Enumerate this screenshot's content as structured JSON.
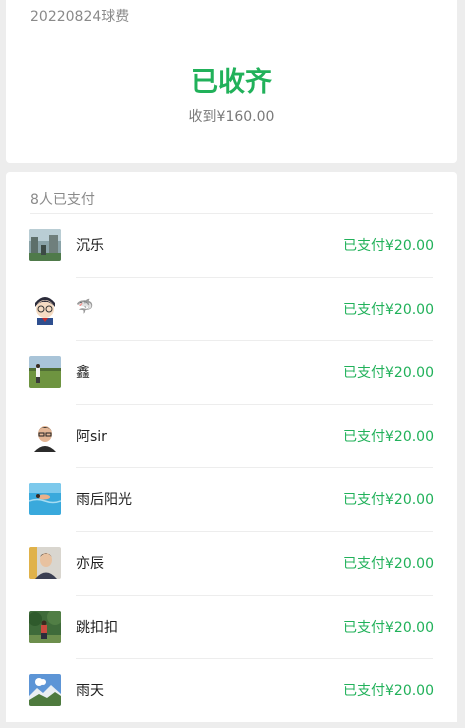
{
  "event": {
    "title": "20220824球费",
    "status": "已收齐",
    "received": "收到¥160.00"
  },
  "payments": {
    "count_label": "8人已支付",
    "items": [
      {
        "name": "沉乐",
        "amount": "已支付¥20.00",
        "avatar": "avatar-city-scene"
      },
      {
        "name": "🦈",
        "amount": "已支付¥20.00",
        "avatar": "avatar-cartoon-detective"
      },
      {
        "name": "鑫",
        "amount": "已支付¥20.00",
        "avatar": "avatar-person-field"
      },
      {
        "name": "阿sir",
        "amount": "已支付¥20.00",
        "avatar": "avatar-person-glasses"
      },
      {
        "name": "雨后阳光",
        "amount": "已支付¥20.00",
        "avatar": "avatar-swimming-pool"
      },
      {
        "name": "亦辰",
        "amount": "已支付¥20.00",
        "avatar": "avatar-person-portrait"
      },
      {
        "name": "跳扣扣",
        "amount": "已支付¥20.00",
        "avatar": "avatar-person-trees"
      },
      {
        "name": "雨天",
        "amount": "已支付¥20.00",
        "avatar": "avatar-mountain-sky"
      }
    ]
  },
  "colors": {
    "accent": "#21b15a",
    "background": "#ededed"
  }
}
